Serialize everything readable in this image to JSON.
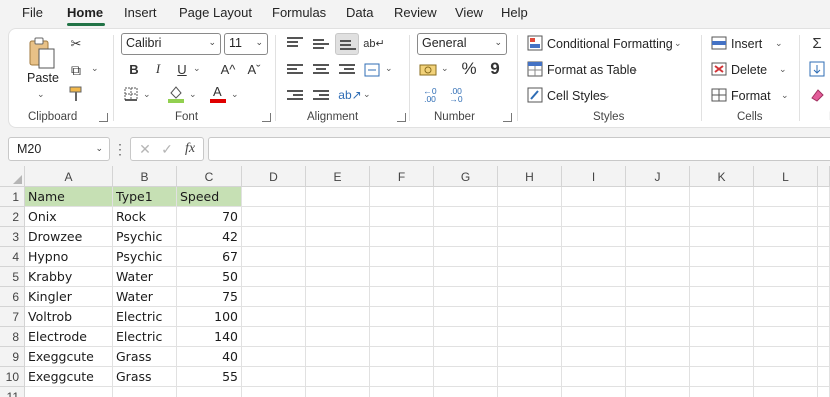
{
  "menu": [
    {
      "label": "File",
      "active": false
    },
    {
      "label": "Home",
      "active": true
    },
    {
      "label": "Insert",
      "active": false
    },
    {
      "label": "Page Layout",
      "active": false
    },
    {
      "label": "Formulas",
      "active": false
    },
    {
      "label": "Data",
      "active": false
    },
    {
      "label": "Review",
      "active": false
    },
    {
      "label": "View",
      "active": false
    },
    {
      "label": "Help",
      "active": false
    }
  ],
  "ribbon": {
    "clipboard": {
      "group_label": "Clipboard",
      "paste_label": "Paste"
    },
    "font": {
      "group_label": "Font",
      "font_name": "Calibri",
      "font_size": "11",
      "bold": "B",
      "italic": "I",
      "underline": "U",
      "grow": "A^",
      "shrink": "Aˇ",
      "fill_color": "#92d050",
      "font_color": "#e00000"
    },
    "alignment": {
      "group_label": "Alignment"
    },
    "number": {
      "group_label": "Number",
      "format": "General",
      "percent": "%",
      "comma": "9"
    },
    "styles": {
      "group_label": "Styles",
      "conditional_formatting": "Conditional Formatting",
      "format_as_table": "Format as Table",
      "cell_styles": "Cell Styles"
    },
    "cells": {
      "group_label": "Cells",
      "insert": "Insert",
      "delete": "Delete",
      "format": "Format"
    },
    "editing": {
      "group_label": "E"
    }
  },
  "formula_bar": {
    "name_box": "M20",
    "formula": ""
  },
  "grid": {
    "columns": [
      "A",
      "B",
      "C",
      "D",
      "E",
      "F",
      "G",
      "H",
      "I",
      "J",
      "K",
      "L"
    ],
    "row_numbers": [
      "1",
      "2",
      "3",
      "4",
      "5",
      "6",
      "7",
      "8",
      "9",
      "10",
      "11"
    ],
    "header_fill": "#c6e0b4",
    "rows": [
      [
        "Name",
        "Type1",
        "Speed"
      ],
      [
        "Onix",
        "Rock",
        "70"
      ],
      [
        "Drowzee",
        "Psychic",
        "42"
      ],
      [
        "Hypno",
        "Psychic",
        "67"
      ],
      [
        "Krabby",
        "Water",
        "50"
      ],
      [
        "Kingler",
        "Water",
        "75"
      ],
      [
        "Voltrob",
        "Electric",
        "100"
      ],
      [
        "Electrode",
        "Electric",
        "140"
      ],
      [
        "Exeggcute",
        "Grass",
        "40"
      ],
      [
        "Exeggcute",
        "Grass",
        "55"
      ]
    ]
  }
}
